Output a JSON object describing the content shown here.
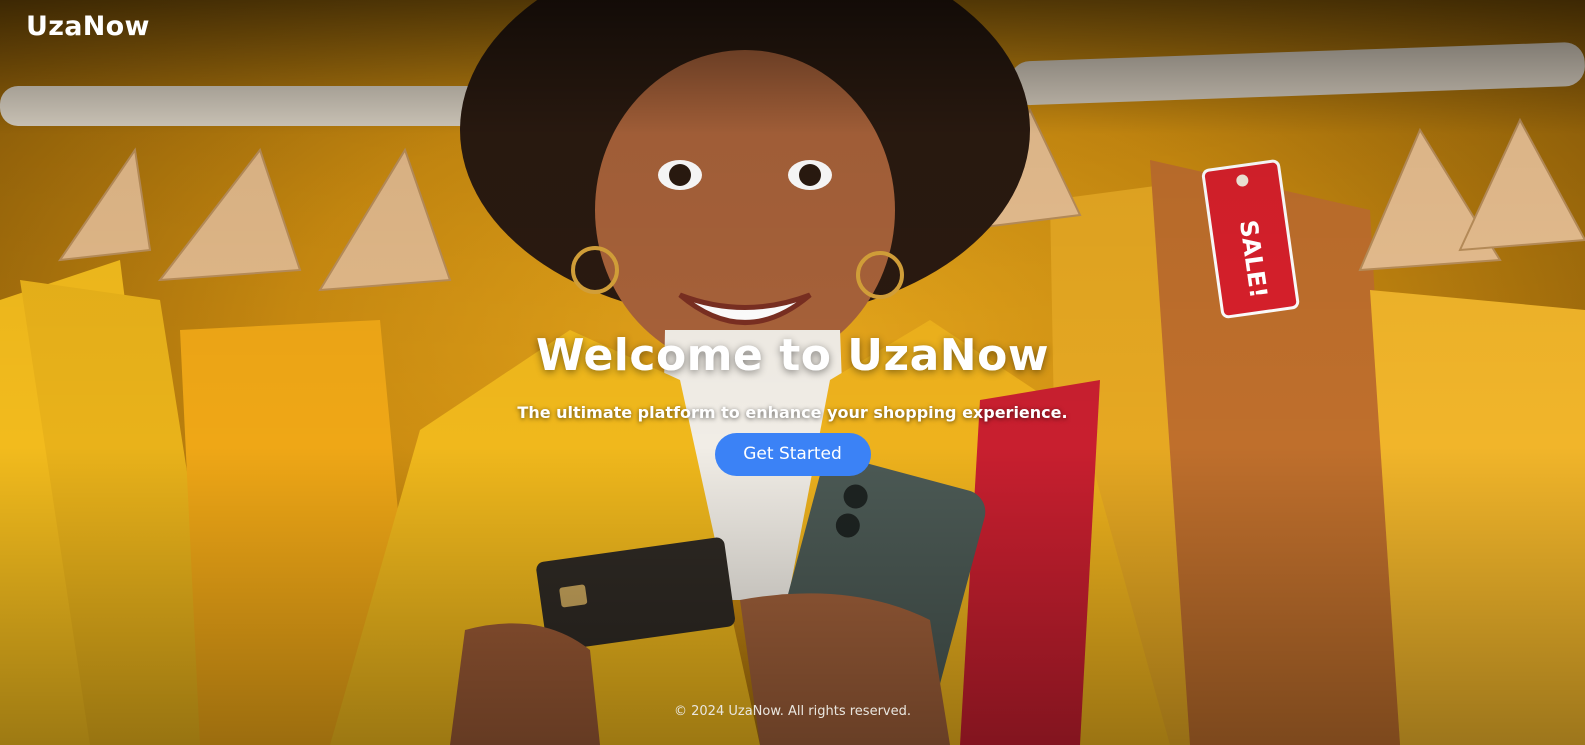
{
  "navbar": {
    "brand": "UzaNow"
  },
  "hero": {
    "title": "Welcome to UzaNow",
    "subtitle": "The ultimate platform to enhance your shopping experience.",
    "cta_label": "Get Started",
    "sale_tag_text": "SALE!"
  },
  "footer": {
    "text": "© 2024 UzaNow. All rights reserved."
  },
  "colors": {
    "cta_background": "#3b82f6",
    "text": "#ffffff",
    "backdrop": "#e8a81c",
    "sale_tag": "#d8202b"
  }
}
